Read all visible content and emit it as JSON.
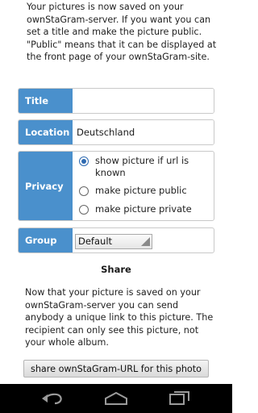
{
  "intro": {
    "text": "Your pictures is now saved on your ownStaGram-server. If you want you can set a title and make the picture public. \"Public\" means that it can be displayed at the front page of your ownStaGram-site."
  },
  "form": {
    "title": {
      "label": "Title",
      "value": ""
    },
    "location": {
      "label": "Location",
      "value": "Deutschland"
    },
    "privacy": {
      "label": "Privacy",
      "options": [
        {
          "label": "show picture if url is known",
          "checked": true
        },
        {
          "label": "make picture public",
          "checked": false
        },
        {
          "label": "make picture private",
          "checked": false
        }
      ]
    },
    "group": {
      "label": "Group",
      "selected": "Default"
    }
  },
  "share": {
    "heading": "Share",
    "text": "Now that your picture is saved on your ownStaGram-server you can send anybody a unique link to this picture. The recipient can only see this picture, not your whole album.",
    "button_label": "share ownStaGram-URL for this photo"
  },
  "navbar": {
    "icons": [
      "back-icon",
      "home-icon",
      "recent-apps-icon"
    ]
  },
  "colors": {
    "label_bg": "#4a90cc",
    "navbar_bg": "#000000",
    "radio_accent": "#2e6ab1"
  }
}
